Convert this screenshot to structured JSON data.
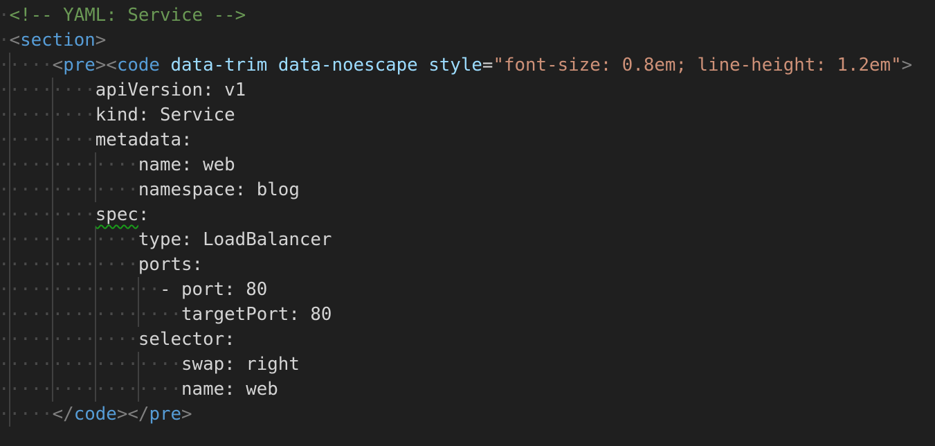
{
  "colors": {
    "background": "#1f1f1f",
    "comment": "#6a9955",
    "tag_bracket": "#808080",
    "tag_name": "#569cd6",
    "attribute": "#9cdcfe",
    "string": "#ce9178",
    "text": "#d4d4d4",
    "warning_squiggle": "#1a9c1a"
  },
  "lines": [
    {
      "indent": 1,
      "tokens": [
        {
          "t": "comment",
          "v": "<!-- YAML: Service -->"
        }
      ]
    },
    {
      "indent": 1,
      "tokens": [
        {
          "t": "punct",
          "v": "<"
        },
        {
          "t": "tag",
          "v": "section"
        },
        {
          "t": "punct",
          "v": ">"
        }
      ]
    },
    {
      "indent": 5,
      "tokens": [
        {
          "t": "punct",
          "v": "<"
        },
        {
          "t": "tag",
          "v": "pre"
        },
        {
          "t": "punct",
          "v": "><"
        },
        {
          "t": "tag",
          "v": "code"
        },
        {
          "t": "text",
          "v": " "
        },
        {
          "t": "attr",
          "v": "data-trim"
        },
        {
          "t": "text",
          "v": " "
        },
        {
          "t": "attr",
          "v": "data-noescape"
        },
        {
          "t": "text",
          "v": " "
        },
        {
          "t": "attr",
          "v": "style"
        },
        {
          "t": "eq",
          "v": "="
        },
        {
          "t": "string",
          "v": "\"font-size: 0.8em; line-height: 1.2em\""
        },
        {
          "t": "punct",
          "v": ">"
        }
      ]
    },
    {
      "indent": 9,
      "tokens": [
        {
          "t": "text",
          "v": "apiVersion: v1"
        }
      ]
    },
    {
      "indent": 9,
      "tokens": [
        {
          "t": "text",
          "v": "kind: Service"
        }
      ]
    },
    {
      "indent": 9,
      "tokens": [
        {
          "t": "text",
          "v": "metadata:"
        }
      ]
    },
    {
      "indent": 13,
      "tokens": [
        {
          "t": "text",
          "v": "name: web"
        }
      ]
    },
    {
      "indent": 13,
      "tokens": [
        {
          "t": "text",
          "v": "namespace: blog"
        }
      ]
    },
    {
      "indent": 9,
      "tokens": [
        {
          "t": "text",
          "v": "spec",
          "warning": true
        },
        {
          "t": "text",
          "v": ":"
        }
      ]
    },
    {
      "indent": 13,
      "tokens": [
        {
          "t": "text",
          "v": "type: LoadBalancer"
        }
      ]
    },
    {
      "indent": 13,
      "tokens": [
        {
          "t": "text",
          "v": "ports:"
        }
      ]
    },
    {
      "indent": 15,
      "tokens": [
        {
          "t": "text",
          "v": "- port: 80"
        }
      ]
    },
    {
      "indent": 17,
      "tokens": [
        {
          "t": "text",
          "v": "targetPort: 80"
        }
      ]
    },
    {
      "indent": 13,
      "tokens": [
        {
          "t": "text",
          "v": "selector:"
        }
      ]
    },
    {
      "indent": 17,
      "tokens": [
        {
          "t": "text",
          "v": "swap: right"
        }
      ]
    },
    {
      "indent": 17,
      "tokens": [
        {
          "t": "text",
          "v": "name: web"
        }
      ]
    },
    {
      "indent": 5,
      "tokens": [
        {
          "t": "punct",
          "v": "</"
        },
        {
          "t": "tag",
          "v": "code"
        },
        {
          "t": "punct",
          "v": "></"
        },
        {
          "t": "tag",
          "v": "pre"
        },
        {
          "t": "punct",
          "v": ">"
        }
      ]
    }
  ]
}
